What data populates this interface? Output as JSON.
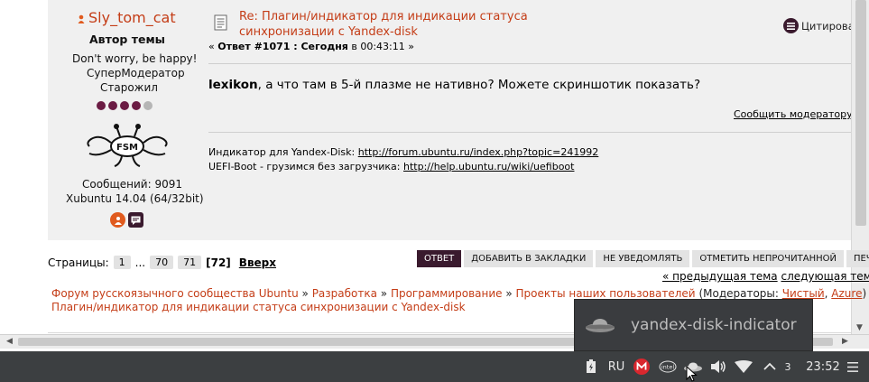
{
  "author": {
    "name": "Sly_tom_cat",
    "role": "Автор темы",
    "quote": "Don't worry, be happy!",
    "rank": "СуперМодератор",
    "level": "Старожил",
    "posts": "Сообщений: 9091",
    "os": "Xubuntu 14.04 (64/32bit)",
    "rating_filled": 4,
    "rating_total": 5
  },
  "post": {
    "title": "Re: Плагин/индикатор для индикации статуса синхронизации с Yandex-disk",
    "meta_prefix": "« ",
    "meta_number": "Ответ #1071 : Сегодня",
    "meta_time": " в 00:43:11 »",
    "quote_label": "Цитировать",
    "body_user": "lexikon",
    "body_text": ", а что там в 5-й плазме не нативно? Можете скриншотик показать?",
    "report_label": "Сообщить модератору",
    "sig_line1_label": "Индикатор для Yandex-Disk: ",
    "sig_line1_link": "http://forum.ubuntu.ru/index.php?topic=241992",
    "sig_line2_label": "UEFI-Boot - грузимся без загрузчика: ",
    "sig_line2_link": "http://help.ubuntu.ru/wiki/uefiboot"
  },
  "pagination": {
    "label": "Страницы:",
    "items": [
      "1",
      "...",
      "70",
      "71"
    ],
    "current": "[72]",
    "up": "Вверх"
  },
  "actions": [
    "ОТВЕТ",
    "ДОБАВИТЬ В ЗАКЛАДКИ",
    "НЕ УВЕДОМЛЯТЬ",
    "ОТМЕТИТЬ НЕПРОЧИТАННОЙ",
    "ПЕЧАТЬ"
  ],
  "prevnext": {
    "prev": "« предыдущая тема",
    "next": "следующая тема »"
  },
  "breadcrumbs": {
    "items": [
      "Форум русскоязычного сообщества Ubuntu",
      "Разработка",
      "Программирование",
      "Проекты наших пользователей"
    ],
    "sep": " » ",
    "mod_prefix": "(Модераторы: ",
    "mod1": "Чистый",
    "mod_comma": ", ",
    "mod2": "Azure",
    "mod_suffix": ")",
    "last": "Плагин/индикатор для индикации статуса синхронизации с Yandex-disk"
  },
  "tooltip": "yandex-disk-indicator",
  "taskbar": {
    "lang": "RU",
    "notif_count": "3",
    "time": "23:52"
  },
  "colors": {
    "accent": "#c43d17",
    "dark": "#3a1a2e",
    "taskbar": "#3c3f41"
  }
}
